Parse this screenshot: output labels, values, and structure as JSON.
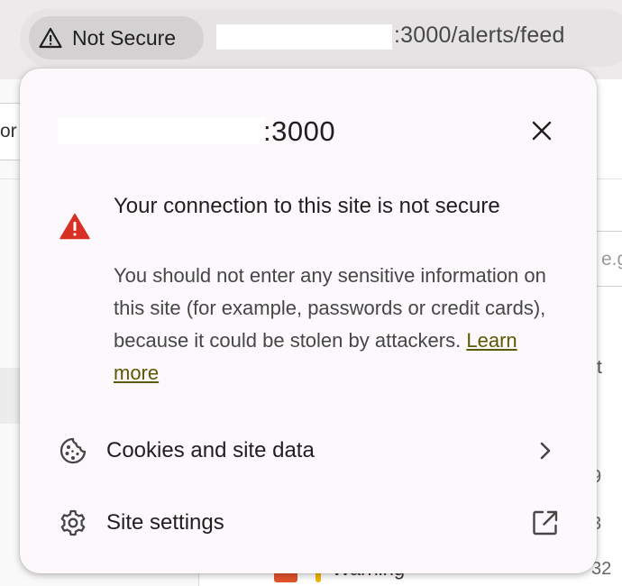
{
  "chrome": {
    "security_chip_label": "Not Secure",
    "url_rest": ":3000/alerts/feed"
  },
  "background": {
    "filter_text": "or",
    "input_placeholder": "e.g",
    "column_label": "t",
    "numbers": [
      "9",
      "3",
      "32"
    ],
    "warning_text": "Warning"
  },
  "popup": {
    "host_port": ":3000",
    "title": "Your connection to this site is not secure",
    "body": "You should not enter any sensitive information on this site (for example, passwords or credit cards), because it could be stolen by attackers.",
    "learn_more": "Learn more",
    "rows": {
      "cookies": "Cookies and site data",
      "site_settings": "Site settings"
    }
  },
  "icons": {
    "security_chip": "warning-triangle-outline-icon",
    "close": "close-icon",
    "warning": "warning-triangle-red-icon",
    "cookies": "cookie-icon",
    "cookies_trailing": "chevron-right-icon",
    "settings": "gear-icon",
    "settings_trailing": "open-in-new-icon"
  },
  "colors": {
    "warning_red": "#d93025",
    "link": "#5b5a00",
    "popup_bg": "#fcf8fc"
  }
}
